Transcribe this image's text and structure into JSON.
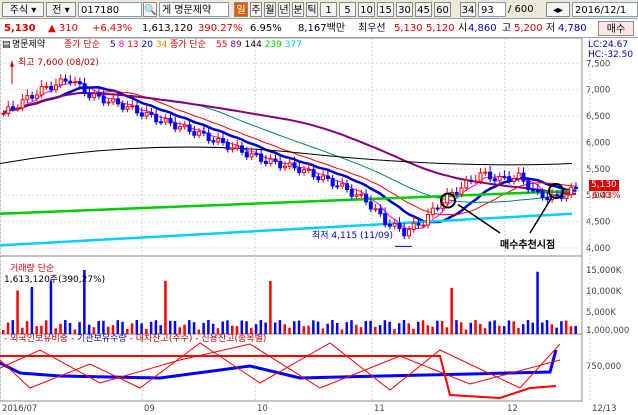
{
  "toolbar": {
    "menu_label": "주식",
    "market_label": "전",
    "code": "017180",
    "company_prefix": "게",
    "company": "명문제약",
    "active_badge": "일",
    "periods": [
      "주",
      "월",
      "년",
      "분",
      "틱"
    ],
    "minutes": [
      "1",
      "5",
      "10",
      "15",
      "30",
      "45",
      "60"
    ],
    "minute_extra": "34",
    "count_value": "93",
    "ratio_label": "/ 600",
    "date_value": "2016/12/1"
  },
  "quote": {
    "price": "5,130",
    "change": "▲ 310",
    "change_pct": "+6.43%",
    "volume": "1,613,120",
    "vol_ratio": "390.27%",
    "turnover": "6.95%",
    "trade_amount": "8,167백만",
    "pref_label": "최우선",
    "ask": "5,130",
    "bid": "5,120",
    "open_label": "시",
    "open": "4,860",
    "high_label": "고",
    "high": "5,200",
    "low_label": "저",
    "low": "4,780",
    "buy_label": "매수"
  },
  "price_panel": {
    "name_tag": "명문제약",
    "legend_prefix": "종가 단순",
    "legend1": [
      "5",
      "8",
      "13",
      "20",
      "34"
    ],
    "legend2_prefix": "종가 단순",
    "legend2": [
      "55",
      "89",
      "144",
      "239",
      "377"
    ],
    "lc_label": "LC:24.67",
    "hc_label": "HC:-32.50",
    "max_annot": "최고 7,600 (08/02)",
    "min_annot": "최저 4,115 (11/09)",
    "signal_label": "매수추천시점",
    "current_price_tag": "5,130",
    "current_pct_tag": "6.43%",
    "yaxis": [
      "7,500",
      "7,000",
      "6,500",
      "6,000",
      "5,500",
      "5,000",
      "4,500",
      "4,000"
    ]
  },
  "volume_panel": {
    "title": "거래량 단순",
    "value": "1,613,120주(390,27%)",
    "yaxis": [
      "15,000K",
      "10,000K",
      "5,000K"
    ]
  },
  "flow_panel": {
    "legend": [
      "외국인보유비중",
      "기관보유수량",
      "대차잔고(주수)",
      "신용잔고(종목별)"
    ],
    "yaxis": [
      "1,000,000",
      "750,000"
    ]
  },
  "xaxis": [
    "2016/07",
    "09",
    "10",
    "11",
    "12",
    "12/13"
  ],
  "colors": {
    "up": "#ff0000",
    "down": "#0000ff",
    "ma5": "#0000d0",
    "ma20": "#ff0000",
    "ma60": "#800080",
    "ma120": "#00cc00",
    "ma239": "#00c8ff"
  }
}
